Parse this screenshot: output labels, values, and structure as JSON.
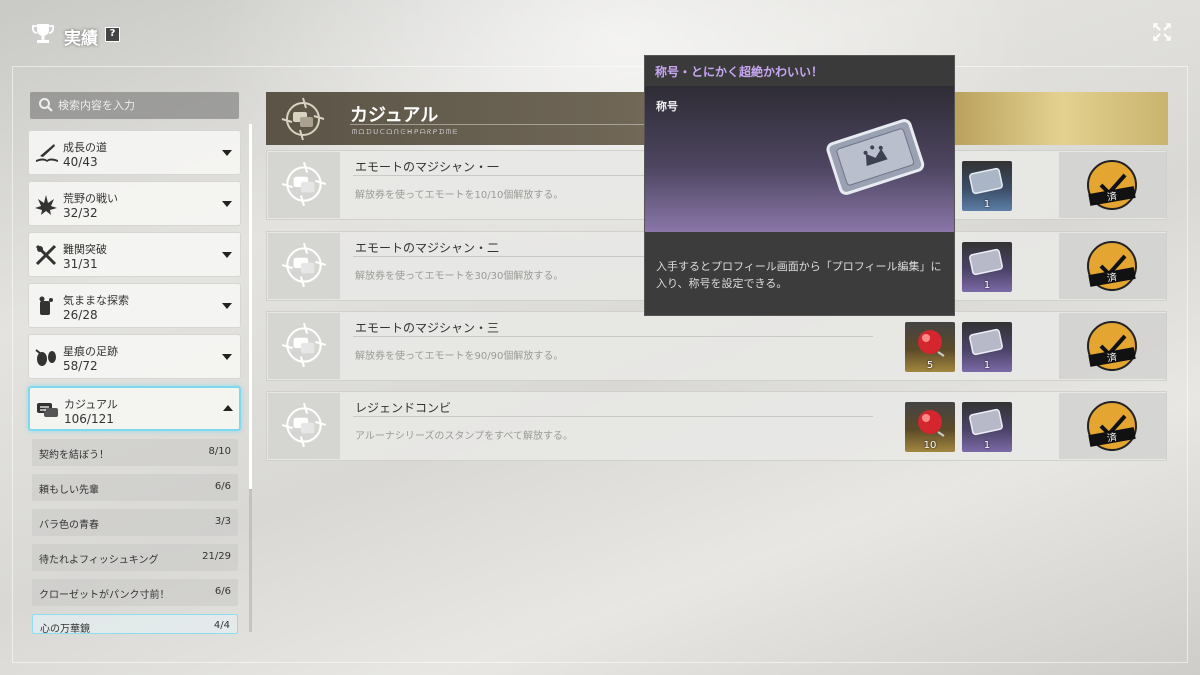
{
  "window": {
    "title": "実績",
    "help_label": "?"
  },
  "search": {
    "placeholder": "検索内容を入力"
  },
  "categories": [
    {
      "name": "成長の道",
      "count": "40/43",
      "icon": "book-quill-icon"
    },
    {
      "name": "荒野の戦い",
      "count": "32/32",
      "icon": "wasteland-battle-icon"
    },
    {
      "name": "難関突破",
      "count": "31/31",
      "icon": "crossed-swords-icon"
    },
    {
      "name": "気ままな探索",
      "count": "26/28",
      "icon": "explore-icon"
    },
    {
      "name": "星痕の足跡",
      "count": "58/72",
      "icon": "footprint-icon"
    },
    {
      "name": "カジュアル",
      "count": "106/121",
      "icon": "chat-bubble-icon"
    }
  ],
  "subcategories": [
    {
      "name": "契約を結ぼう！",
      "count": "8/10"
    },
    {
      "name": "頼もしい先輩",
      "count": "6/6"
    },
    {
      "name": "バラ色の青春",
      "count": "3/3"
    },
    {
      "name": "待たれよフィッシュキング",
      "count": "21/29"
    },
    {
      "name": "クローゼットがパンク寸前！",
      "count": "6/6"
    },
    {
      "name": "心の万華鏡",
      "count": "4/4"
    }
  ],
  "header": {
    "name": "カジュアル",
    "subtitle": "ᗰᗝᗪᑌᑕᗝᑎᕮᕼᑭᗩᖇᑭᗪᗰᗴ"
  },
  "achievements": [
    {
      "name": "エモートのマジシャン・一",
      "desc": "解放券を使ってエモートを10/10個解放する。",
      "rewards": [
        {
          "type": "ticket",
          "color": "blue",
          "qty": "1"
        }
      ],
      "stamp": "済"
    },
    {
      "name": "エモートのマジシャン・二",
      "desc": "解放券を使ってエモートを30/30個解放する。",
      "rewards": [
        {
          "type": "ticket",
          "color": "purple",
          "qty": "1"
        }
      ],
      "stamp": "済"
    },
    {
      "name": "エモートのマジシャン・三",
      "desc": "解放券を使ってエモートを90/90個解放する。",
      "rewards": [
        {
          "type": "gem",
          "color": "gold",
          "qty": "5"
        },
        {
          "type": "ticket",
          "color": "purple",
          "qty": "1"
        }
      ],
      "stamp": "済"
    },
    {
      "name": "レジェンドコンビ",
      "desc": "アルーナシリーズのスタンプをすべて解放する。",
      "rewards": [
        {
          "type": "gem",
          "color": "gold",
          "qty": "10"
        },
        {
          "type": "ticket",
          "color": "purple",
          "qty": "1"
        }
      ],
      "stamp": "済"
    }
  ],
  "tooltip": {
    "title": "称号・とにかく超絶かわいい！",
    "label": "称号",
    "description": "入手するとプロフィール画面から「プロフィール編集」に入り、称号を設定できる。"
  }
}
